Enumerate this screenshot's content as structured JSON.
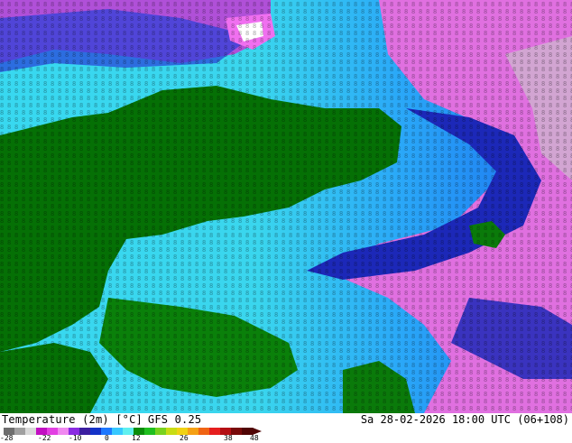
{
  "map": {
    "variable_label": "Temperature (2m) [°C]",
    "model_label": "GFS 0.25",
    "datetime_label": "Sa 28-02-2026 18:00 UTC (06+108)"
  },
  "legend": {
    "ticks": [
      "-28",
      "-22",
      "-10",
      "0",
      "12",
      "26",
      "38",
      "48"
    ],
    "colors": [
      "#6e6e6e",
      "#a0a0a0",
      "#d9d9d9",
      "#c20fc2",
      "#e23fe2",
      "#f088f0",
      "#8a2be2",
      "#3c1ea0",
      "#1432c8",
      "#1e78ff",
      "#36c8ff",
      "#5ff0f0",
      "#0a8c0a",
      "#1fbf1f",
      "#78d21e",
      "#c8dc14",
      "#f0d214",
      "#f5a014",
      "#f06414",
      "#e61e1e",
      "#b40f14",
      "#780a0a",
      "#500505"
    ],
    "colors_extra": {
      "land": "#057005",
      "water_warm": "#40e0e8",
      "water_cold": "#1830c8",
      "ice": "#e060e0"
    }
  }
}
